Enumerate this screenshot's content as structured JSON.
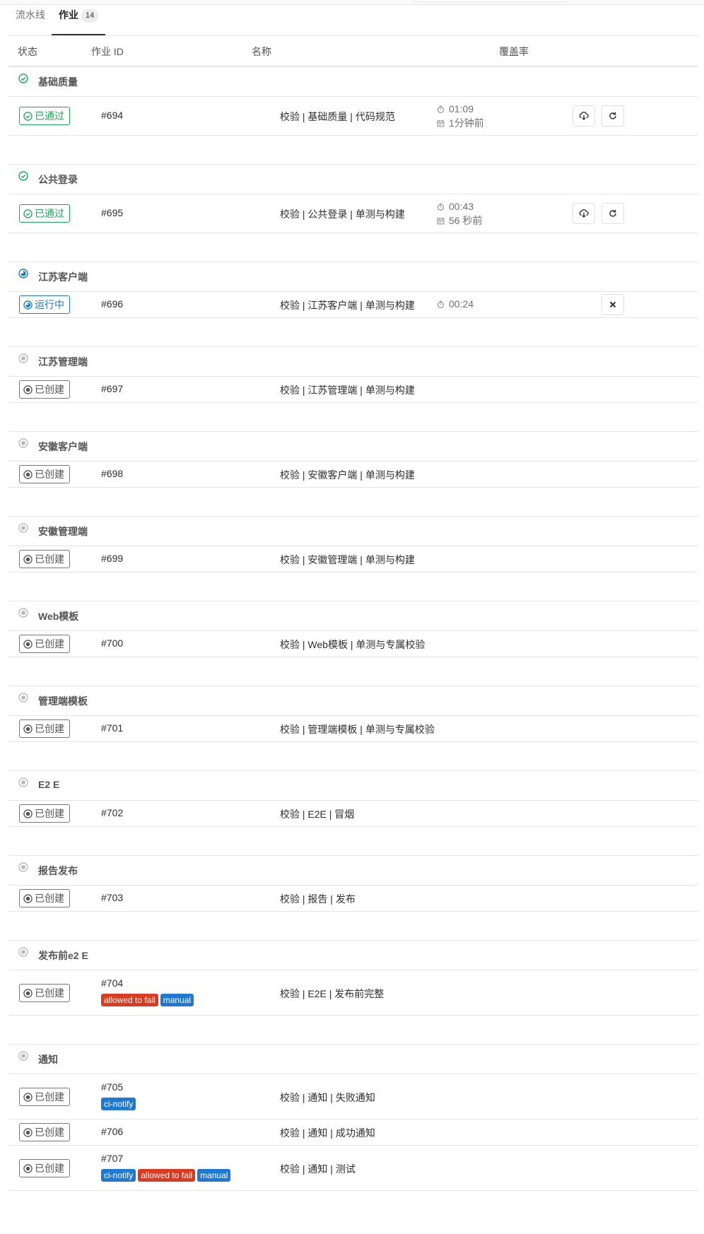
{
  "tabs": [
    {
      "label": "流水线"
    },
    {
      "label": "作业",
      "count": "14"
    }
  ],
  "columns": {
    "status": "状态",
    "job_id": "作业 ID",
    "name": "名称",
    "coverage": "覆盖率"
  },
  "status_colors": {
    "passed": "#1aaa55",
    "running": "#1f78d1",
    "created": "#777777",
    "allowed_to_fail": "#db3b21",
    "manual": "#1f78d1"
  },
  "stages": [
    {
      "name": "基础质量",
      "status": "passed",
      "jobs": [
        {
          "status_label": "已通过",
          "id": "#694",
          "name": "校验 | 基础质量 | 代码规范",
          "duration": "01:09",
          "finished": "1分钟前",
          "actions": [
            "download-icon",
            "retry-icon"
          ]
        }
      ]
    },
    {
      "name": "公共登录",
      "status": "passed",
      "jobs": [
        {
          "status_label": "已通过",
          "id": "#695",
          "name": "校验 | 公共登录 | 单测与构建",
          "duration": "00:43",
          "finished": "56 秒前",
          "actions": [
            "download-icon",
            "retry-icon"
          ]
        }
      ]
    },
    {
      "name": "江苏客户端",
      "status": "running",
      "jobs": [
        {
          "status_label": "运行中",
          "id": "#696",
          "name": "校验 | 江苏客户端 | 单测与构建",
          "duration": "00:24",
          "actions": [
            "cancel-icon"
          ]
        }
      ]
    },
    {
      "name": "江苏管理端",
      "status": "created",
      "jobs": [
        {
          "status_label": "已创建",
          "id": "#697",
          "name": "校验 | 江苏管理端 | 单测与构建"
        }
      ]
    },
    {
      "name": "安徽客户端",
      "status": "created",
      "jobs": [
        {
          "status_label": "已创建",
          "id": "#698",
          "name": "校验 | 安徽客户端 | 单测与构建"
        }
      ]
    },
    {
      "name": "安徽管理端",
      "status": "created",
      "jobs": [
        {
          "status_label": "已创建",
          "id": "#699",
          "name": "校验 | 安徽管理端 | 单测与构建"
        }
      ]
    },
    {
      "name": "Web模板",
      "status": "created",
      "jobs": [
        {
          "status_label": "已创建",
          "id": "#700",
          "name": "校验 | Web模板 | 单测与专属校验"
        }
      ]
    },
    {
      "name": "管理端模板",
      "status": "created",
      "jobs": [
        {
          "status_label": "已创建",
          "id": "#701",
          "name": "校验 | 管理端模板 | 单测与专属校验"
        }
      ]
    },
    {
      "name": "E2 E",
      "status": "created",
      "jobs": [
        {
          "status_label": "已创建",
          "id": "#702",
          "name": "校验 | E2E | 冒烟"
        }
      ]
    },
    {
      "name": "报告发布",
      "status": "created",
      "jobs": [
        {
          "status_label": "已创建",
          "id": "#703",
          "name": "校验 | 报告 | 发布"
        }
      ]
    },
    {
      "name": "发布前e2 E",
      "status": "created",
      "jobs": [
        {
          "status_label": "已创建",
          "id": "#704",
          "name": "校验 | E2E | 发布前完整",
          "tags": [
            {
              "text": "allowed to fail",
              "kind": "fail"
            },
            {
              "text": "manual",
              "kind": "manual"
            }
          ]
        }
      ]
    },
    {
      "name": "通知",
      "status": "created",
      "jobs": [
        {
          "status_label": "已创建",
          "id": "#705",
          "name": "校验 | 通知 | 失败通知",
          "tags": [
            {
              "text": "ci-notify",
              "kind": "notify"
            }
          ]
        },
        {
          "status_label": "已创建",
          "id": "#706",
          "name": "校验 | 通知 | 成功通知"
        },
        {
          "status_label": "已创建",
          "id": "#707",
          "name": "校验 | 通知 | 测试",
          "tags": [
            {
              "text": "ci-notify",
              "kind": "notify"
            },
            {
              "text": "allowed to fail",
              "kind": "fail"
            },
            {
              "text": "manual",
              "kind": "manual"
            }
          ]
        }
      ]
    }
  ]
}
